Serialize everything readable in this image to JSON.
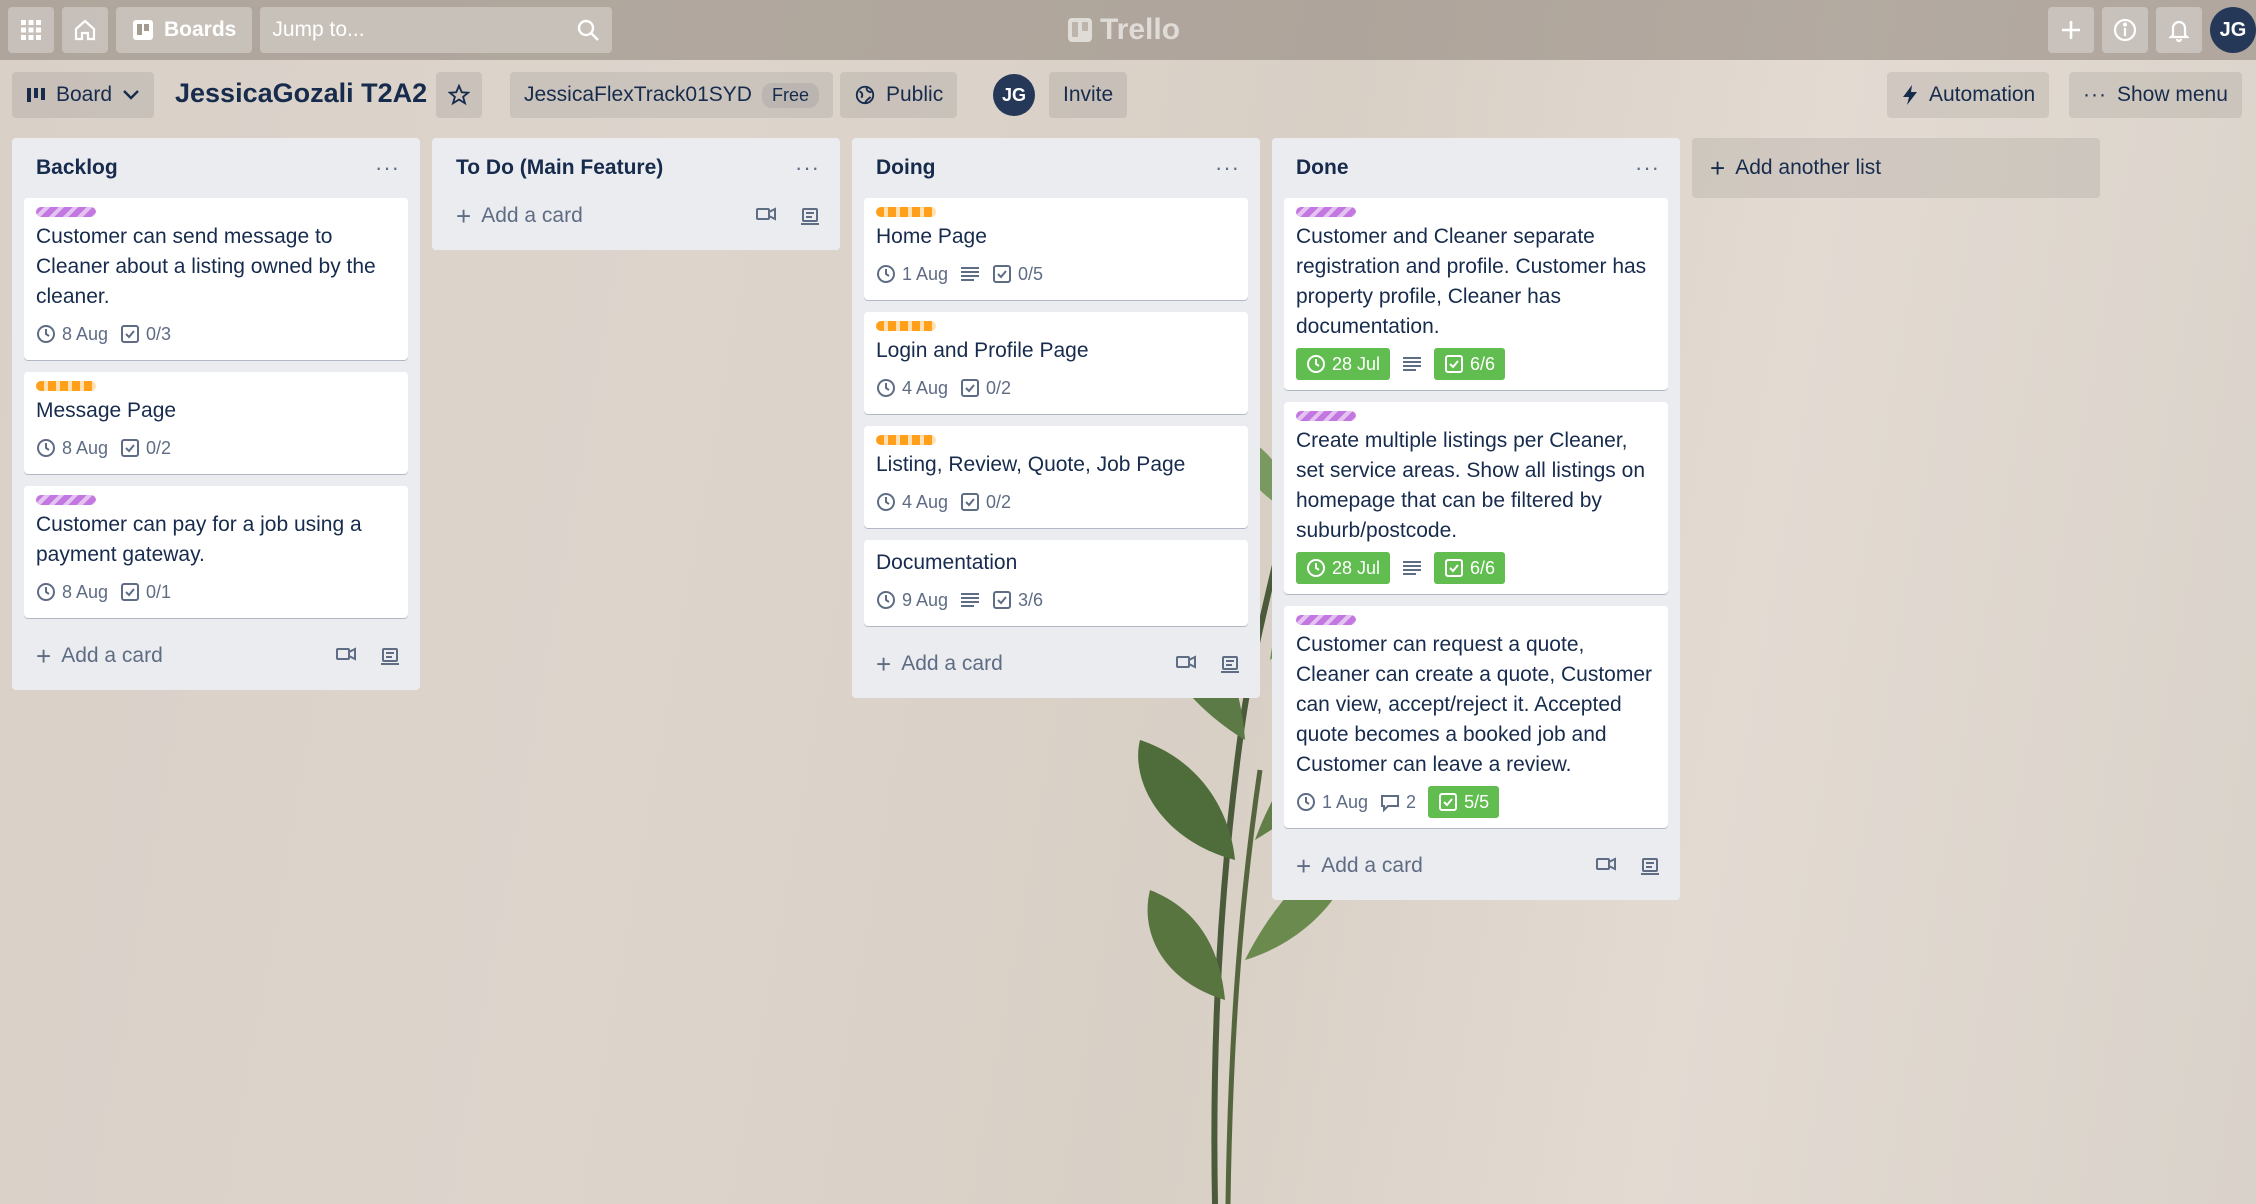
{
  "topbar": {
    "boards_label": "Boards",
    "search_placeholder": "Jump to...",
    "logo_text": "Trello",
    "avatar_initials": "JG"
  },
  "boardbar": {
    "view_label": "Board",
    "board_title": "JessicaGozali T2A2",
    "workspace": "JessicaFlexTrack01SYD",
    "plan": "Free",
    "visibility": "Public",
    "member_initials": "JG",
    "invite_label": "Invite",
    "automation_label": "Automation",
    "show_menu_label": "Show menu"
  },
  "lists": [
    {
      "title": "Backlog",
      "add_label": "Add a card",
      "cards": [
        {
          "label": "purple",
          "title": "Customer can send message to Cleaner about a listing owned by the cleaner.",
          "due": "8 Aug",
          "checklist": "0/3"
        },
        {
          "label": "orange",
          "title": "Message Page",
          "due": "8 Aug",
          "checklist": "0/2"
        },
        {
          "label": "purple",
          "title": "Customer can pay for a job using a payment gateway.",
          "due": "8 Aug",
          "checklist": "0/1"
        }
      ]
    },
    {
      "title": "To Do (Main Feature)",
      "add_label": "Add a card",
      "cards": []
    },
    {
      "title": "Doing",
      "add_label": "Add a card",
      "cards": [
        {
          "label": "orange",
          "title": "Home Page",
          "due": "1 Aug",
          "description": true,
          "checklist": "0/5"
        },
        {
          "label": "orange",
          "title": "Login and Profile Page",
          "due": "4 Aug",
          "checklist": "0/2"
        },
        {
          "label": "orange",
          "title": "Listing, Review, Quote, Job Page",
          "due": "4 Aug",
          "checklist": "0/2"
        },
        {
          "label": "",
          "title": "Documentation",
          "due": "9 Aug",
          "description": true,
          "checklist": "3/6"
        }
      ]
    },
    {
      "title": "Done",
      "add_label": "Add a card",
      "cards": [
        {
          "label": "purple",
          "title": "Customer and Cleaner separate registration and profile. Customer has property profile, Cleaner has documentation.",
          "due": "28 Jul",
          "due_complete": true,
          "description": true,
          "checklist": "6/6",
          "checklist_complete": true
        },
        {
          "label": "purple",
          "title": "Create multiple listings per Cleaner, set service areas. Show all listings on homepage that can be filtered by suburb/postcode.",
          "due": "28 Jul",
          "due_complete": true,
          "description": true,
          "checklist": "6/6",
          "checklist_complete": true
        },
        {
          "label": "purple",
          "title": "Customer can request a quote, Cleaner can create a quote, Customer can view, accept/reject it. Accepted quote becomes a booked job and Customer can leave a review.",
          "due": "1 Aug",
          "comments": "2",
          "checklist": "5/5",
          "checklist_complete": true
        }
      ]
    }
  ],
  "add_list_label": "Add another list"
}
